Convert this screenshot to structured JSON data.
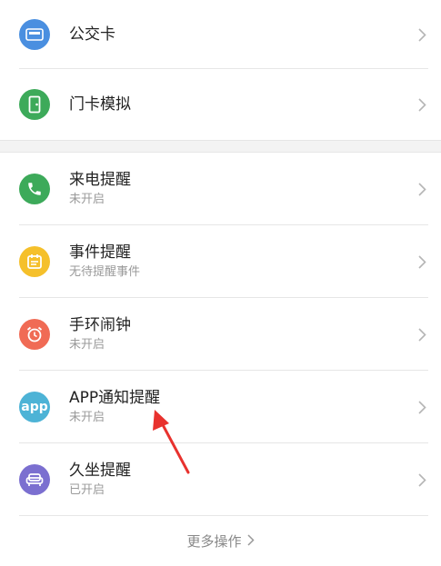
{
  "cards": [
    {
      "title": "公交卡",
      "icon": "bus-card-icon",
      "color": "#4a8fe0"
    },
    {
      "title": "门卡模拟",
      "icon": "door-card-icon",
      "color": "#3daa5a"
    }
  ],
  "reminders": [
    {
      "title": "来电提醒",
      "status": "未开启",
      "icon": "phone-icon",
      "color": "#3daa5a"
    },
    {
      "title": "事件提醒",
      "status": "无待提醒事件",
      "icon": "calendar-icon",
      "color": "#f5c02b"
    },
    {
      "title": "手环闹钟",
      "status": "未开启",
      "icon": "alarm-clock-icon",
      "color": "#f06b55"
    },
    {
      "title": "APP通知提醒",
      "status": "未开启",
      "icon": "app-icon",
      "app_text": "app",
      "color": "#4db3d6"
    },
    {
      "title": "久坐提醒",
      "status": "已开启",
      "icon": "sofa-icon",
      "color": "#7b6fd0"
    }
  ],
  "more_actions": {
    "label": "更多操作"
  },
  "annotation": {
    "color": "#e8322e"
  }
}
